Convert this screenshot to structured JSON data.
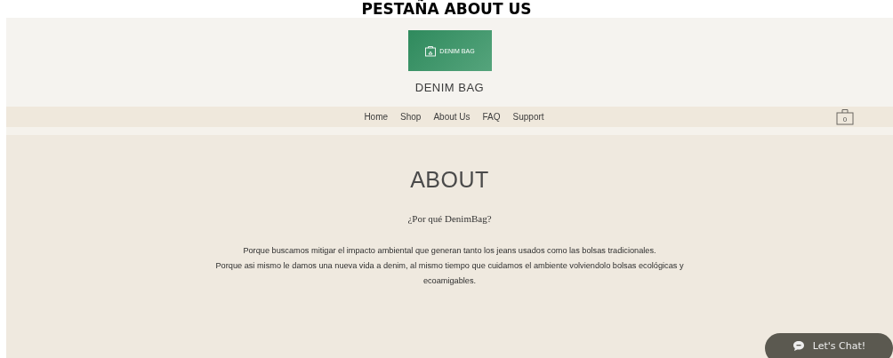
{
  "slide_title": "PESTAÑA ABOUT US",
  "header": {
    "logo_text": "DENIM BAG",
    "site_name": "DENIM BAG"
  },
  "nav": {
    "items": [
      {
        "label": "Home"
      },
      {
        "label": "Shop"
      },
      {
        "label": "About Us"
      },
      {
        "label": "FAQ"
      },
      {
        "label": "Support"
      }
    ],
    "cart_count": "0"
  },
  "main": {
    "heading": "ABOUT",
    "subheading": "¿Por qué DenimBag?",
    "paragraphs": [
      "Porque buscamos mitigar el impacto ambiental que generan tanto los jeans usados como las bolsas tradicionales.",
      "Porque asi mismo le damos una nueva vida a denim, al mismo tiempo que cuidamos el ambiente volviendolo bolsas ecológicas y ecoamigables."
    ]
  },
  "chat": {
    "label": "Let's Chat!"
  }
}
